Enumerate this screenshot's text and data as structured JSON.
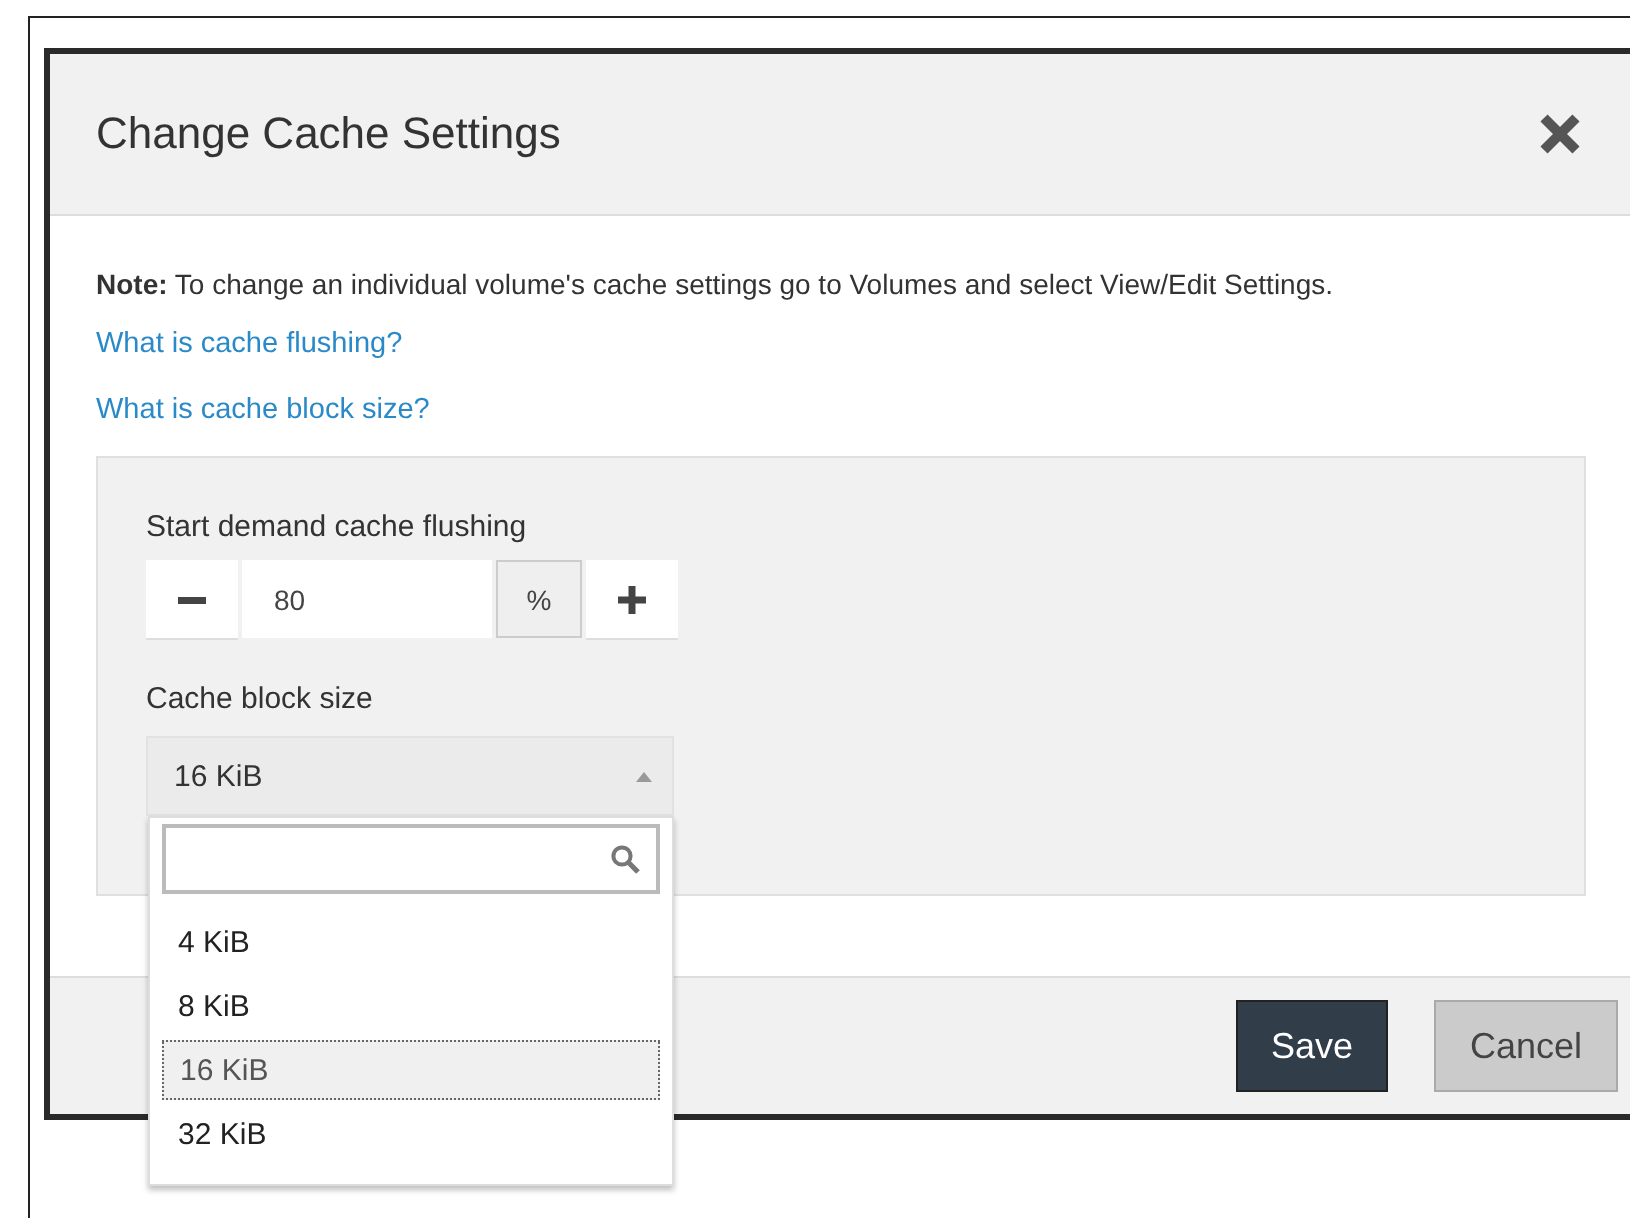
{
  "dialog": {
    "title": "Change Cache Settings",
    "note": "**Note:** To change an individual volume's cache settings go to Volumes and select View/Edit Settings.",
    "links": [
      "What is cache flushing?",
      "What is cache block size?"
    ],
    "flushing": {
      "label": "Start demand cache flushing",
      "value": "80",
      "unit": "%"
    },
    "block_size": {
      "label": "Cache block size",
      "value": "16 KiB",
      "expanded": true,
      "options": [
        {
          "label": "4 KiB",
          "selected": false
        },
        {
          "label": "8 KiB",
          "selected": false
        },
        {
          "label": "16 KiB",
          "selected": true
        },
        {
          "label": "32 KiB",
          "selected": false
        }
      ]
    },
    "buttons": [
      {
        "label": "Save",
        "kind": "primary"
      },
      {
        "label": "Cancel",
        "kind": "secondary"
      }
    ]
  }
}
